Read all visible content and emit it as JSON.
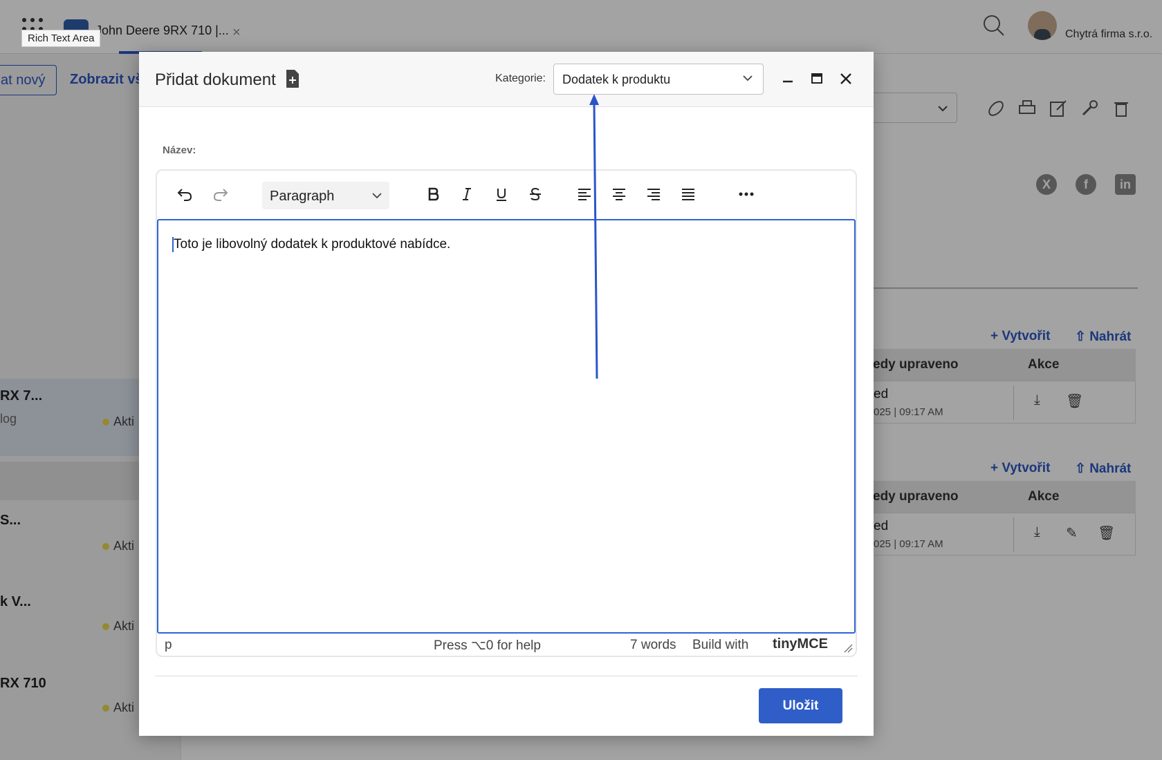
{
  "app": {
    "tab_title": "John Deere 9RX 710 |...",
    "tab_close": "×",
    "tooltip": "Rich Text Area",
    "company": "Chytrá firma s.r.o."
  },
  "left": {
    "new_button": "at nový",
    "show_button": "Zobrazit vš",
    "items": [
      {
        "title": "RX 7...",
        "sub": "log",
        "status": "Akti"
      },
      {
        "title": "S...",
        "sub": "",
        "status": "Akti"
      },
      {
        "title": "k V...",
        "sub": "",
        "status": "Akti"
      },
      {
        "title": "RX 710",
        "sub": "",
        "status": "Akti"
      }
    ]
  },
  "right": {
    "create_label": "Vytvořit",
    "upload_label": "Nahrát",
    "col_modified": "edy upraveno",
    "col_actions": "Akce",
    "rows": [
      {
        "name": "ed",
        "date": "025 | 09:17 AM"
      },
      {
        "name": "ed",
        "date": "025 | 09:17 AM"
      }
    ]
  },
  "modal": {
    "title": "Přidat dokument",
    "category_label": "Kategorie:",
    "category_value": "Dodatek k produktu",
    "name_label": "Název:",
    "editor": {
      "block_format": "Paragraph",
      "content": "Toto je libovolný dodatek k produktové nabídce.",
      "status_path": "p",
      "status_help": "Press ⌥0 for help",
      "status_words": "7 words",
      "status_build": "Build with",
      "status_brand": "tinyMCE"
    },
    "save_label": "Uložit"
  },
  "colors": {
    "accent": "#2f5ec8",
    "focus_border": "#2f64d0",
    "annotation_arrow": "#2a55c9"
  },
  "icons": [
    "apps-grid-icon",
    "document-add-icon",
    "chevron-down-icon",
    "minimize-icon",
    "maximize-icon",
    "close-icon",
    "undo-icon",
    "redo-icon",
    "bold-icon",
    "italic-icon",
    "underline-icon",
    "strikethrough-icon",
    "align-left-icon",
    "align-center-icon",
    "align-right-icon",
    "justify-icon",
    "more-icon",
    "search-icon",
    "download-icon",
    "trash-icon",
    "edit-icon",
    "print-icon",
    "link-icon",
    "wrench-icon"
  ]
}
